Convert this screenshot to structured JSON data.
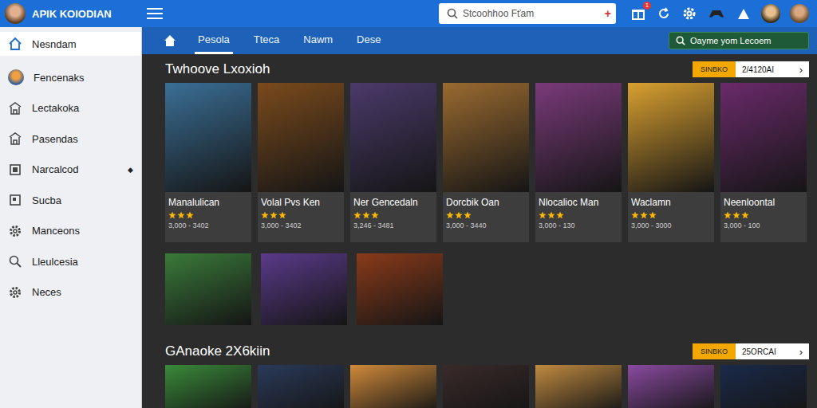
{
  "window": {
    "title": "APIK KOIODIAN"
  },
  "header": {
    "search": {
      "placeholder": "Stcoohhoo Fťam",
      "add": "+"
    },
    "notifications": "1"
  },
  "sidebar": {
    "items": [
      {
        "label": "Nesndam",
        "selected": true,
        "icon": "home"
      },
      {
        "label": "Fencenaks",
        "selected": false,
        "icon": "avatar"
      },
      {
        "label": "Lectakoka",
        "selected": false,
        "icon": "store"
      },
      {
        "label": "Pasendas",
        "selected": false,
        "icon": "store"
      },
      {
        "label": "Narcalcod",
        "selected": false,
        "icon": "box",
        "marker": "◆"
      },
      {
        "label": "Sucba",
        "selected": false,
        "icon": "page"
      },
      {
        "label": "Manceons",
        "selected": false,
        "icon": "gear"
      },
      {
        "label": "Lleulcesia",
        "selected": false,
        "icon": "search"
      },
      {
        "label": "Neces",
        "selected": false,
        "icon": "gear"
      }
    ]
  },
  "tabs": [
    {
      "label": "Pesola",
      "selected": true
    },
    {
      "label": "Ttecа",
      "selected": false
    },
    {
      "label": "Nawm",
      "selected": false
    },
    {
      "label": "Dese",
      "selected": false
    }
  ],
  "store_search": {
    "placeholder": "Oayme yom Lecoem"
  },
  "sections": [
    {
      "title": "Twhoove Lxoxioh",
      "badge": "SINBKO",
      "more": "2/4120AI",
      "arrow": "›",
      "cards": [
        {
          "title": "Manalulican",
          "stars": 3,
          "price": "3,000 - 3402",
          "color": "#3a6f96"
        },
        {
          "title": "Volal Pvs Ken",
          "stars": 3,
          "price": "3,000 - 3402",
          "color": "#7a4a1c"
        },
        {
          "title": "Ner Gencedaln",
          "stars": 3,
          "price": "3,246 - 3481",
          "color": "#4a3a6a"
        },
        {
          "title": "Dorcbik Oan",
          "stars": 3,
          "price": "3,000 - 3440",
          "color": "#9a6a30"
        },
        {
          "title": "Nlocalioc Man",
          "stars": 3,
          "price": "3,000 - 130",
          "color": "#7a3a7a"
        },
        {
          "title": "Waclamn",
          "stars": 3,
          "price": "3,000 - 3000",
          "color": "#d9a030"
        },
        {
          "title": "Neenloontal",
          "stars": 3,
          "price": "3,000 - 100",
          "color": "#6a2a6a"
        }
      ],
      "tiles": [
        {
          "color": "#3a7a3a"
        },
        {
          "color": "#5a3a8a"
        },
        {
          "color": "#8a3a1a"
        }
      ]
    },
    {
      "title": "GAnaoke 2X6kiin",
      "badge": "SINBKO",
      "more": "25ORCAI",
      "arrow": "›",
      "cards": [
        {
          "color": "#3a8a3a"
        },
        {
          "color": "#2a3a5a"
        },
        {
          "color": "#d08a3a"
        },
        {
          "color": "#3a2a2a"
        },
        {
          "color": "#c08a40"
        },
        {
          "color": "#8a4aa0"
        },
        {
          "color": "#1a2a4a"
        }
      ],
      "tiles": []
    }
  ]
}
